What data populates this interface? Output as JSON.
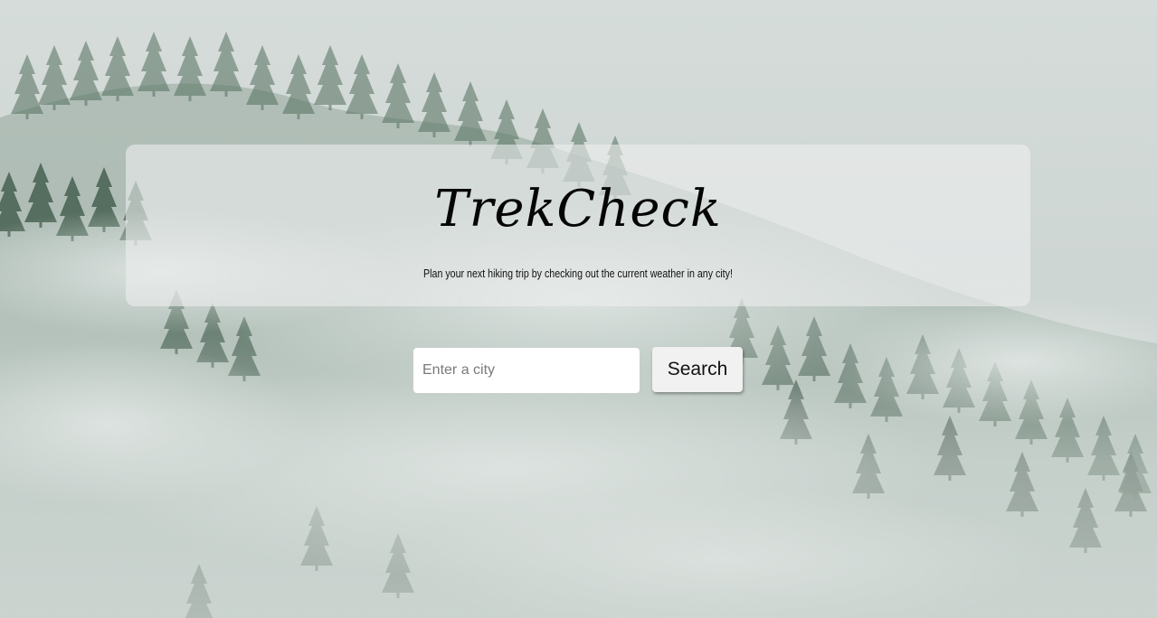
{
  "app": {
    "title": "TrekCheck",
    "tagline": "Plan your next hiking trip by checking out the current weather in any city!"
  },
  "search": {
    "placeholder": "Enter a city",
    "value": "",
    "button_label": "Search"
  },
  "background": {
    "image": "misty-forest",
    "sky_color": "#d2dbd9",
    "tree_color": "#3e5546"
  }
}
